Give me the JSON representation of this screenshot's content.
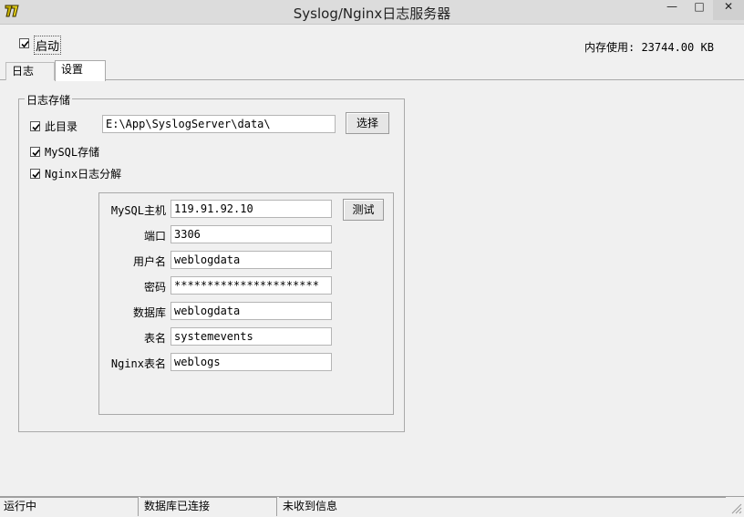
{
  "window": {
    "title": "Syslog/Nginx日志服务器",
    "min_glyph": "—",
    "max_glyph": "□",
    "close_glyph": "✕"
  },
  "top": {
    "start_label": "启动",
    "start_checked": true,
    "memory_text": "内存使用: 23744.00 KB"
  },
  "tabs": [
    {
      "label": "日志",
      "active": false
    },
    {
      "label": "设置",
      "active": true
    }
  ],
  "storage": {
    "group_title": "日志存储",
    "dir_label": "此目录",
    "dir_value": "E:\\App\\SyslogServer\\data\\",
    "browse_label": "选择",
    "mysql_label": "MySQL存储",
    "nginx_label": "Nginx日志分解"
  },
  "mysql": {
    "host_label": "MySQL主机",
    "host_value": "119.91.92.10",
    "test_label": "测试",
    "port_label": "端口",
    "port_value": "3306",
    "user_label": "用户名",
    "user_value": "weblogdata",
    "pass_label": "密码",
    "pass_value": "**********************",
    "db_label": "数据库",
    "db_value": "weblogdata",
    "table_label": "表名",
    "table_value": "systemevents",
    "nginx_table_label": "Nginx表名",
    "nginx_table_value": "weblogs"
  },
  "status": {
    "running": "运行中",
    "db": "数据库已连接",
    "msg": "未收到信息"
  }
}
